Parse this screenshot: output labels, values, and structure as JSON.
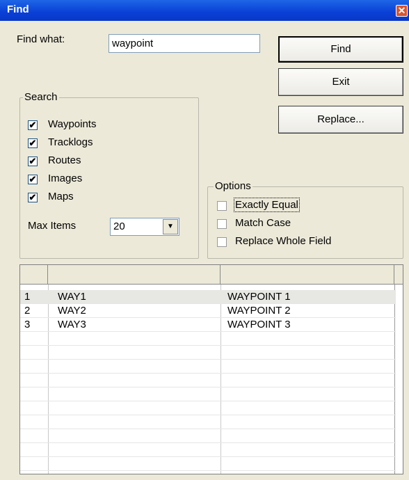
{
  "window": {
    "title": "Find",
    "close_glyph": "✕"
  },
  "find_what": {
    "label": "Find what:",
    "value": "waypoint"
  },
  "buttons": {
    "find": "Find",
    "exit": "Exit",
    "replace": "Replace..."
  },
  "search": {
    "legend": "Search",
    "items": [
      {
        "label": "Waypoints",
        "checked": true
      },
      {
        "label": "Tracklogs",
        "checked": true
      },
      {
        "label": "Routes",
        "checked": true
      },
      {
        "label": "Images",
        "checked": true
      },
      {
        "label": "Maps",
        "checked": true
      }
    ],
    "max_items_label": "Max Items",
    "max_items_value": "20"
  },
  "options": {
    "legend": "Options",
    "items": [
      {
        "label": "Exactly Equal",
        "checked": false
      },
      {
        "label": "Match Case",
        "checked": false
      },
      {
        "label": "Replace Whole Field",
        "checked": false
      }
    ]
  },
  "results": {
    "rows": [
      {
        "num": "1",
        "id": "WAY1",
        "name": "WAYPOINT  1"
      },
      {
        "num": "2",
        "id": "WAY2",
        "name": "WAYPOINT  2"
      },
      {
        "num": "3",
        "id": "WAY3",
        "name": "WAYPOINT  3"
      }
    ]
  },
  "check_glyph": "✔",
  "dropdown_glyph": "▼"
}
